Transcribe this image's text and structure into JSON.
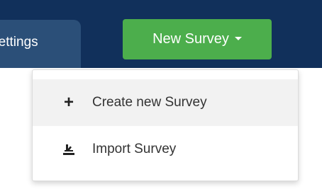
{
  "nav": {
    "settings_tab_label": "Settings"
  },
  "new_survey_button": {
    "label": "New Survey",
    "caret_icon": "caret-down-icon",
    "color": "#4cae4c"
  },
  "dropdown": {
    "items": [
      {
        "label": "Create new Survey",
        "icon": "plus-icon"
      },
      {
        "label": "Import Survey",
        "icon": "import-icon"
      }
    ]
  },
  "colors": {
    "navbar": "#11305b",
    "active_tab": "#2b4f78",
    "hover_item": "#f2f2f2"
  }
}
